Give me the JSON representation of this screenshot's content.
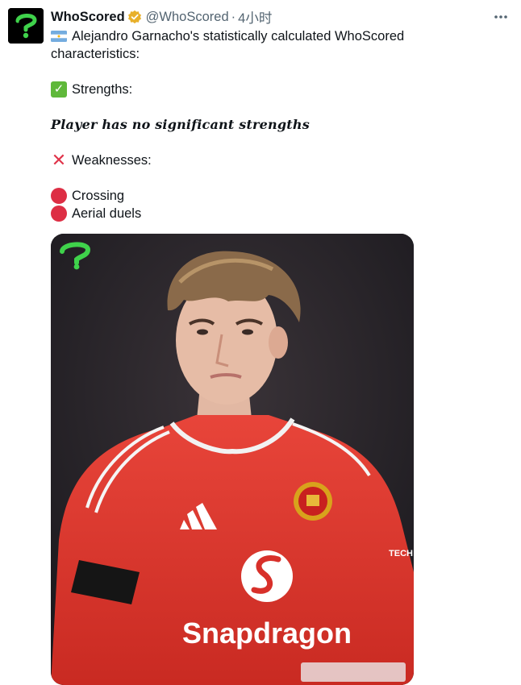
{
  "account": {
    "display_name": "WhoScored",
    "handle": "@WhoScored",
    "separator": "·",
    "time": "4小时",
    "verified_badge_color": "#e8b02a"
  },
  "tweet": {
    "intro": "Alejandro Garnacho's statistically calculated WhoScored",
    "intro_line2": "characteristics:",
    "strengths_label": "Strengths:",
    "strengths_text": "Player has no significant strengths",
    "weaknesses_label": "Weaknesses:",
    "weaknesses": [
      "Crossing",
      "Aerial duels"
    ]
  },
  "media": {
    "shirt_sponsor": "Snapdragon",
    "side_text": "TECH",
    "logo_color": "#3fd24b",
    "shirt_color": "#e2372c"
  },
  "icons": {
    "more": "more-icon",
    "flag": "argentina-flag-icon",
    "check": "check-mark-icon",
    "cross": "cross-mark-icon",
    "circle": "red-circle-icon"
  }
}
